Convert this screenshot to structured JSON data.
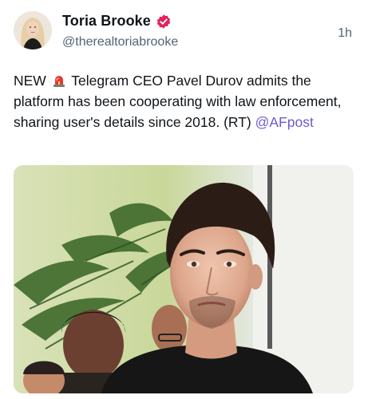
{
  "post": {
    "author": {
      "display_name": "Toria Brooke",
      "handle": "@therealtoriabrooke",
      "verified_icon": "verified-badge-icon",
      "verified_color": "#e0245e"
    },
    "timestamp": "1h",
    "text": {
      "prefix": "NEW",
      "siren_icon": "police-siren-icon",
      "body": " Telegram CEO Pavel Durov admits the platform has been cooperating with law enforcement, sharing user's details since 2018. (RT) ",
      "mention": "@AFpost"
    },
    "media": {
      "type": "photo",
      "subject": "man in black t-shirt with people and palm leaves behind"
    },
    "colors": {
      "mention": "#6b5ccf",
      "secondary_text": "#536471",
      "primary_text": "#0f1419"
    }
  }
}
